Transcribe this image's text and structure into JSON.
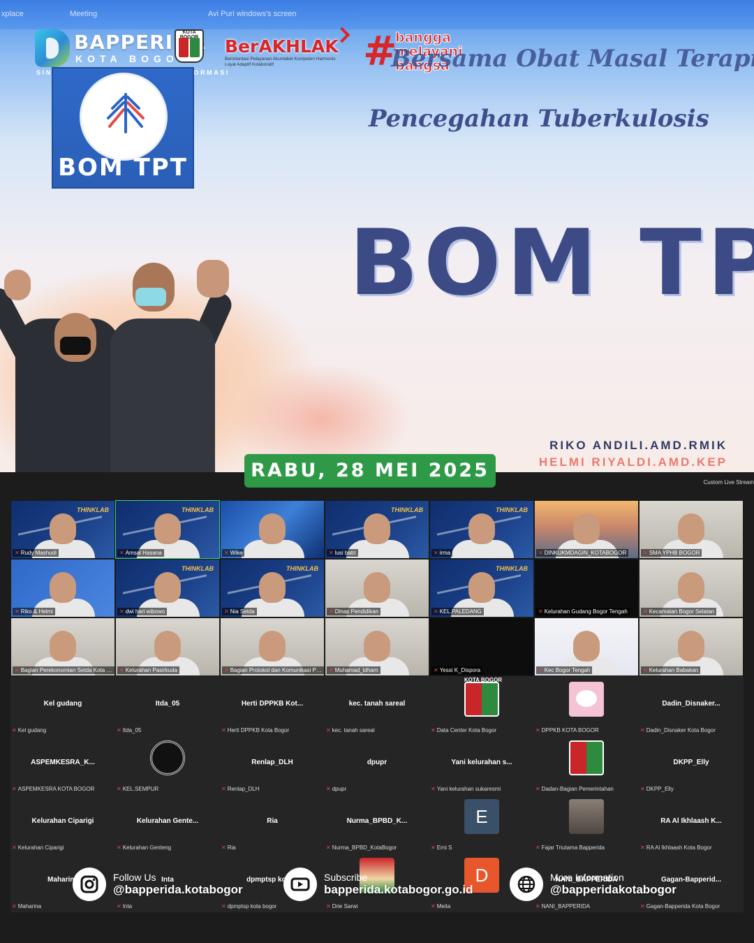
{
  "zoom_bar": {
    "left_text": "xplace",
    "meeting": "Meeting",
    "share": "Avi Puri windows's screen"
  },
  "header": {
    "logo_title": "BAPPERIDA",
    "logo_subtitle": "KOTA BOGOR",
    "logo_tagline": "SINERGI - KOLABORASI - TRANSFORMASI",
    "crest_label": "KOTA BOGOR",
    "berakhlak": "BerAKHLAK",
    "berakhlak_sub": "Berorientasi Pelayanan Akuntabel Kompeten Harmonis Loyal Adaptif Kolaboratif",
    "bangga_hash": "#",
    "bangga_1": "bangga",
    "bangga_2": "melayani",
    "bangga_3": "bangsa"
  },
  "slide": {
    "heading_line1": "Bersama Obat Masal Terapi",
    "heading_line2": "Pencegahan Tuberkulosis",
    "badge_text": "BOM TPT",
    "big_title": "BOM TPT",
    "presenter_1": "RIKO ANDILI.AMD.RMIK",
    "presenter_2": "HELMI RIYALDI.AMD.KEP"
  },
  "date": "RABU, 28 MEI 2025",
  "live_stream_label": "Custom Live Stream",
  "video_tiles": [
    {
      "name": "Rudy Mashudi",
      "bg": "think"
    },
    {
      "name": "Amsal Hasana",
      "bg": "think",
      "active": true
    },
    {
      "name": "Wike",
      "bg": "blue"
    },
    {
      "name": "lusi batri",
      "bg": "think"
    },
    {
      "name": "irma",
      "bg": "think"
    },
    {
      "name": "DINKUKMDAGIN_KOTABOGOR",
      "bg": "city"
    },
    {
      "name": "SMA YPHB BOGOR",
      "bg": "room"
    },
    {
      "name": "Riko & Helmi",
      "bg": "bom"
    },
    {
      "name": "dwi hari wibowo",
      "bg": "think"
    },
    {
      "name": "Nia Setda",
      "bg": "think"
    },
    {
      "name": "Dinas Pendidikan",
      "bg": "room"
    },
    {
      "name": "KEL.PALEDANG",
      "bg": "think"
    },
    {
      "name": "Kelurahan Gudang Bogor Tengah",
      "bg": "black"
    },
    {
      "name": "Kecamatan Bogor Selatan",
      "bg": "room"
    },
    {
      "name": "Bagian Perekonomian Setda Kota Bogor",
      "bg": "room"
    },
    {
      "name": "Kelurahan Pasirkuda",
      "bg": "room"
    },
    {
      "name": "Bagian Protokol dan Komunikasi Pimpinan",
      "bg": "room"
    },
    {
      "name": "Muhamad_ldham",
      "bg": "room"
    },
    {
      "name": "Yessi K_Dispora",
      "bg": "black"
    },
    {
      "name": "Kec Bogor Tengah",
      "bg": "poster"
    },
    {
      "name": "Kelurahan Babakan",
      "bg": "room"
    }
  ],
  "name_tiles": [
    {
      "big": "Kel gudang",
      "small": "Kel gudang"
    },
    {
      "big": "Itda_05",
      "small": "Itda_05"
    },
    {
      "big": "Herti DPPKB Kot...",
      "small": "Herti DPPKB Kota Bogor"
    },
    {
      "big": "kec. tanah sareal",
      "small": "kec. tanah sareal"
    },
    {
      "big": "",
      "small": "Data Center Kota Bogor",
      "avatar": "crest",
      "avatar_text": "KOTA BOGOR"
    },
    {
      "big": "",
      "small": "DPPKB KOTA BOGOR",
      "avatar": "kitty"
    },
    {
      "big": "Dadin_Disnaker...",
      "small": "Dadin_Disnaker Kota Bogor"
    },
    {
      "big": "ASPEMKESRA_K...",
      "small": "ASPEMKESRA KOTA BOGOR"
    },
    {
      "big": "",
      "small": "KEL.SEMPUR",
      "avatar": "seal"
    },
    {
      "big": "Renlap_DLH",
      "small": "Renlap_DLH"
    },
    {
      "big": "dpupr",
      "small": "dpupr"
    },
    {
      "big": "Yani kelurahan s...",
      "small": "Yani kelurahan sukaresmi"
    },
    {
      "big": "",
      "small": "Dadan-Bagian Pemerintahan",
      "avatar": "crest"
    },
    {
      "big": "DKPP_Elly",
      "small": "DKPP_Elly"
    },
    {
      "big": "Kelurahan Ciparigi",
      "small": "Kelurahan Ciparigi"
    },
    {
      "big": "Kelurahan Gente...",
      "small": "Kelurahan Genteng"
    },
    {
      "big": "Ria",
      "small": "Ria"
    },
    {
      "big": "Nurma_BPBD_K...",
      "small": "Nurma_BPBD_KotaBogor"
    },
    {
      "big": "",
      "small": "Erni S",
      "avatar": "letter",
      "letter": "E",
      "color": "#3a5068"
    },
    {
      "big": "",
      "small": "Fajar Triutama Bapperida",
      "avatar": "cat"
    },
    {
      "big": "RA Al Ikhlaash K...",
      "small": "RA Al Ikhlaash Kota Bogor"
    },
    {
      "big": "Maharina",
      "small": "Maharina"
    },
    {
      "big": "Inta",
      "small": "Inta"
    },
    {
      "big": "dpmptsp kota...",
      "small": "dpmptsp kota bogor"
    },
    {
      "big": "",
      "small": "Drie Sarwi",
      "avatar": "poster"
    },
    {
      "big": "",
      "small": "Meita",
      "avatar": "letter",
      "letter": "D",
      "color": "#e8562c"
    },
    {
      "big": "NANI_BAPPERIDA",
      "small": "NANI_BAPPERIDA"
    },
    {
      "big": "Gagan-Bapperid...",
      "small": "Gagan-Bapperida Kota Bogor"
    }
  ],
  "footer": {
    "instagram_label": "Follow Us",
    "instagram_value": "@bapperida.kotabogor",
    "youtube_label": "Subscribe",
    "youtube_value": "bapperida.kotabogor.go.id",
    "web_label": "More Information",
    "web_value": "@bapperidakotabogor"
  },
  "colors": {
    "date_green": "#2e9a48",
    "brand_red": "#d8262b",
    "slide_navy": "#3c4a86",
    "active_speaker": "#3fd36b"
  }
}
